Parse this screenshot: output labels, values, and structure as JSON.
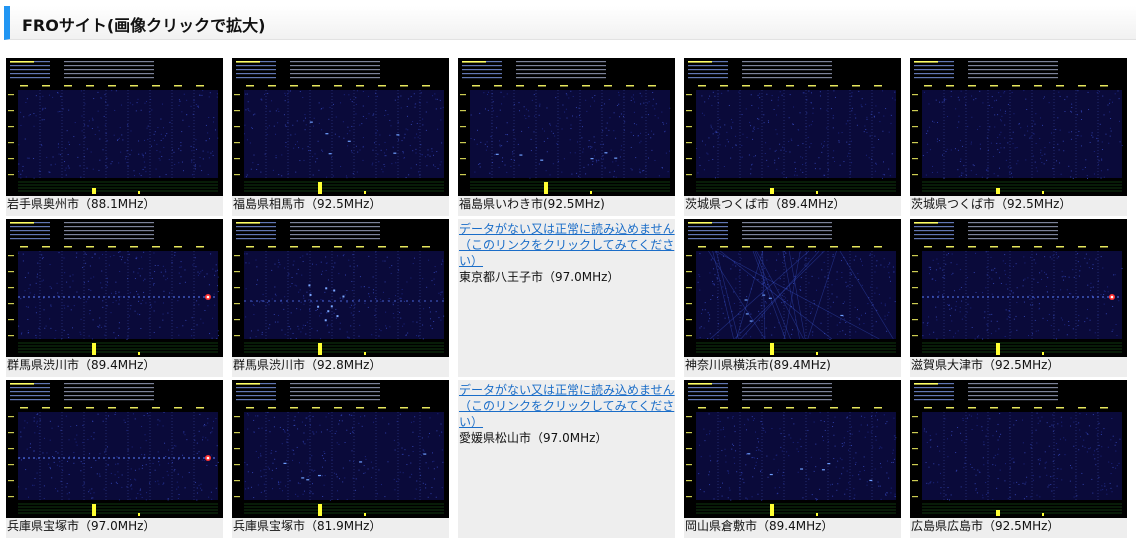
{
  "header": {
    "title": "FROサイト(画像クリックで拡大)"
  },
  "missing_text": "データがない又は正常に読み込めません（このリンクをクリックしてみてください）",
  "stations": [
    {
      "caption": "岩手県奥州市（88.1MHz）",
      "available": true,
      "trace": "none"
    },
    {
      "caption": "福島県相馬市（92.5MHz）",
      "available": true,
      "trace": "faint"
    },
    {
      "caption": "福島県いわき市(92.5MHz)",
      "available": true,
      "trace": "faint"
    },
    {
      "caption": "茨城県つくば市（89.4MHz）",
      "available": true,
      "trace": "none"
    },
    {
      "caption": "茨城県つくば市（92.5MHz）",
      "available": true,
      "trace": "none"
    },
    {
      "caption": "群馬県渋川市（89.4MHz）",
      "available": true,
      "trace": "strong"
    },
    {
      "caption": "群馬県渋川市（92.8MHz）",
      "available": true,
      "trace": "cluster"
    },
    {
      "caption": "東京都八王子市（97.0MHz）",
      "available": false
    },
    {
      "caption": "神奈川県横浜市(89.4MHz)",
      "available": true,
      "trace": "dense"
    },
    {
      "caption": "滋賀県大津市（92.5MHz）",
      "available": true,
      "trace": "strong"
    },
    {
      "caption": "兵庫県宝塚市（97.0MHz）",
      "available": true,
      "trace": "strong"
    },
    {
      "caption": "兵庫県宝塚市（81.9MHz）",
      "available": true,
      "trace": "faint"
    },
    {
      "caption": "愛媛県松山市（97.0MHz）",
      "available": false
    },
    {
      "caption": "岡山県倉敷市（89.4MHz）",
      "available": true,
      "trace": "faint"
    },
    {
      "caption": "広島県広島市（92.5MHz）",
      "available": true,
      "trace": "none"
    }
  ]
}
